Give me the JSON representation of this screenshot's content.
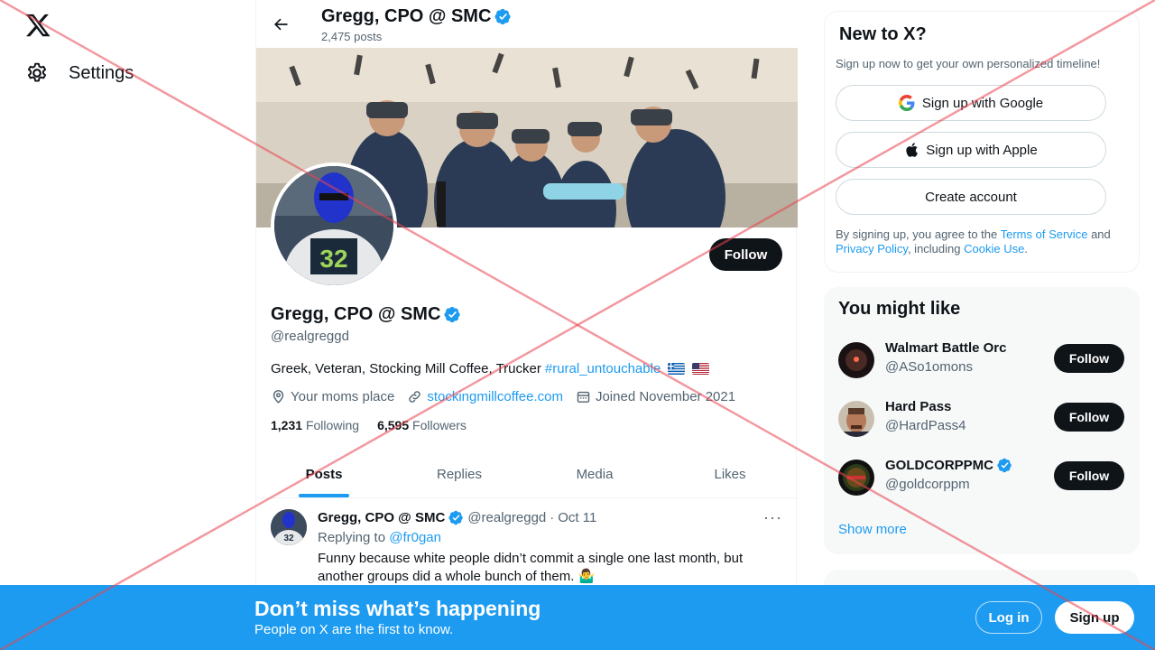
{
  "nav": {
    "settings_label": "Settings"
  },
  "header": {
    "title": "Gregg, CPO @ SMC",
    "post_count": "2,475 posts"
  },
  "profile": {
    "name": "Gregg, CPO @ SMC",
    "handle": "@realgreggd",
    "follow_label": "Follow",
    "bio_text": "Greek, Veteran, Stocking Mill Coffee, Trucker",
    "bio_hashtag": "#rural_untouchable",
    "location": "Your moms place",
    "website": "stockingmillcoffee.com",
    "joined": "Joined November 2021",
    "following_count": "1,231",
    "following_label": "Following",
    "followers_count": "6,595",
    "followers_label": "Followers"
  },
  "tabs": [
    {
      "label": "Posts"
    },
    {
      "label": "Replies"
    },
    {
      "label": "Media"
    },
    {
      "label": "Likes"
    }
  ],
  "tweet": {
    "name": "Gregg, CPO @ SMC",
    "handle": "@realgreggd",
    "sep": "·",
    "date": "Oct 11",
    "more": "···",
    "replying_prefix": "Replying to",
    "replying_to": "@fr0gan",
    "text": "Funny because white people didn’t commit a single one last month, but another groups did a whole bunch of them. 🤷‍♂️"
  },
  "signup_card": {
    "title": "New to X?",
    "subtitle": "Sign up now to get your own personalized timeline!",
    "google_label": "Sign up with Google",
    "apple_label": "Sign up with Apple",
    "create_label": "Create account",
    "legal_prefix": "By signing up, you agree to the",
    "terms": "Terms of Service",
    "and": "and",
    "privacy": "Privacy Policy",
    "including": ", including",
    "cookie": "Cookie Use",
    "period": "."
  },
  "suggestions": {
    "title": "You might like",
    "items": [
      {
        "name": "Walmart Battle Orc",
        "handle": "@ASo1omons",
        "follow": "Follow",
        "verified": false
      },
      {
        "name": "Hard Pass",
        "handle": "@HardPass4",
        "follow": "Follow",
        "verified": false
      },
      {
        "name": "GOLDCORPPMC",
        "handle": "@goldcorppm",
        "follow": "Follow",
        "verified": true
      }
    ],
    "show_more": "Show more"
  },
  "bottom_banner": {
    "title": "Don’t miss what’s happening",
    "subtitle": "People on X are the first to know.",
    "login": "Log in",
    "signup": "Sign up"
  },
  "colors": {
    "accent": "#1d9bf0",
    "text": "#0f1419",
    "muted": "#536471",
    "overlay": "#e8454f"
  }
}
